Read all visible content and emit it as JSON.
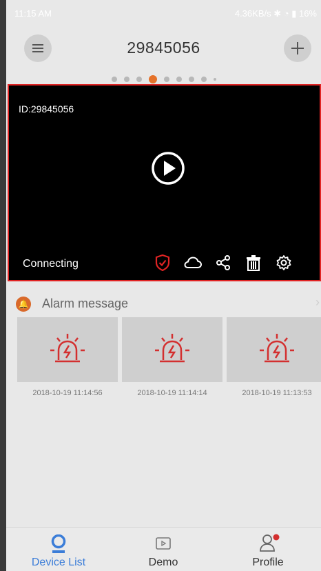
{
  "status_bar": {
    "time": "11:15 AM",
    "right_info": "4.36KB/s",
    "battery": "16%"
  },
  "header": {
    "title": "29845056",
    "menu_icon": "hamburger-icon",
    "add_icon": "plus-icon"
  },
  "pager": {
    "count": 9,
    "active_index": 3
  },
  "video": {
    "device_id": "ID:29845056",
    "status": "Connecting",
    "controls": [
      "shield-icon",
      "cloud-icon",
      "share-icon",
      "delete-icon",
      "settings-icon"
    ],
    "accent_color": "#e02424"
  },
  "alarm": {
    "title": "Alarm message",
    "badge_color": "#d9692a",
    "items": [
      {
        "timestamp": "2018-10-19 11:14:56"
      },
      {
        "timestamp": "2018-10-19 11:14:14"
      },
      {
        "timestamp": "2018-10-19 11:13:53"
      }
    ]
  },
  "bottom_nav": {
    "tabs": [
      {
        "label": "Device List",
        "icon": "camera-icon"
      },
      {
        "label": "Demo",
        "icon": "video-icon"
      },
      {
        "label": "Profile",
        "icon": "person-icon"
      }
    ],
    "active_color": "#3b7dd8"
  }
}
